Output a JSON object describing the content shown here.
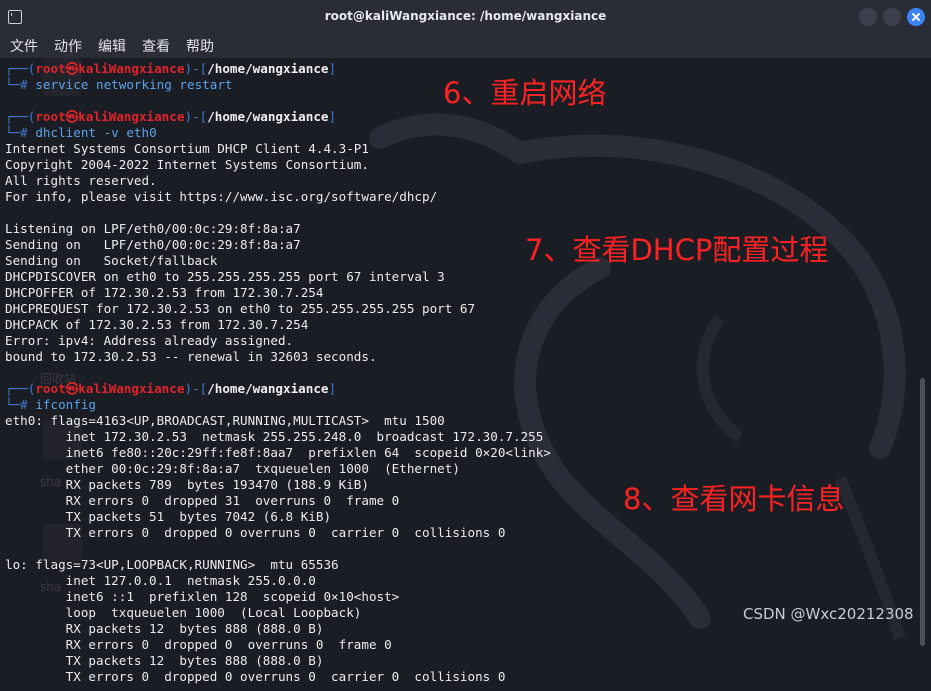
{
  "window": {
    "title": "root@kaliWangxiance: /home/wangxiance"
  },
  "menu": [
    "文件",
    "动作",
    "编辑",
    "查看",
    "帮助"
  ],
  "desktop": {
    "labels": [
      "回收站",
      "sha",
      "sha"
    ]
  },
  "prompt": {
    "user": "root",
    "host": "kaliWangxiance",
    "path": "/home/wangxiance"
  },
  "commands": [
    "service networking restart",
    "dhclient -v eth0",
    "ifconfig"
  ],
  "dhclient_output": [
    "Internet Systems Consortium DHCP Client 4.4.3-P1",
    "Copyright 2004-2022 Internet Systems Consortium.",
    "All rights reserved.",
    "For info, please visit https://www.isc.org/software/dhcp/",
    "",
    "Listening on LPF/eth0/00:0c:29:8f:8a:a7",
    "Sending on   LPF/eth0/00:0c:29:8f:8a:a7",
    "Sending on   Socket/fallback",
    "DHCPDISCOVER on eth0 to 255.255.255.255 port 67 interval 3",
    "DHCPOFFER of 172.30.2.53 from 172.30.7.254",
    "DHCPREQUEST for 172.30.2.53 on eth0 to 255.255.255.255 port 67",
    "DHCPACK of 172.30.2.53 from 172.30.7.254",
    "Error: ipv4: Address already assigned.",
    "bound to 172.30.2.53 -- renewal in 32603 seconds."
  ],
  "ifconfig_output": [
    "eth0: flags=4163<UP,BROADCAST,RUNNING,MULTICAST>  mtu 1500",
    "        inet 172.30.2.53  netmask 255.255.248.0  broadcast 172.30.7.255",
    "        inet6 fe80::20c:29ff:fe8f:8aa7  prefixlen 64  scopeid 0×20<link>",
    "        ether 00:0c:29:8f:8a:a7  txqueuelen 1000  (Ethernet)",
    "        RX packets 789  bytes 193470 (188.9 KiB)",
    "        RX errors 0  dropped 31  overruns 0  frame 0",
    "        TX packets 51  bytes 7042 (6.8 KiB)",
    "        TX errors 0  dropped 0 overruns 0  carrier 0  collisions 0",
    "",
    "lo: flags=73<UP,LOOPBACK,RUNNING>  mtu 65536",
    "        inet 127.0.0.1  netmask 255.0.0.0",
    "        inet6 ::1  prefixlen 128  scopeid 0×10<host>",
    "        loop  txqueuelen 1000  (Local Loopback)",
    "        RX packets 12  bytes 888 (888.0 B)",
    "        RX errors 0  dropped 0  overruns 0  frame 0",
    "        TX packets 12  bytes 888 (888.0 B)",
    "        TX errors 0  dropped 0 overruns 0  carrier 0  collisions 0"
  ],
  "annotations": [
    "6、重启网络",
    "7、查看DHCP配置过程",
    "8、查看网卡信息"
  ],
  "watermark": "CSDN @Wxc20212308",
  "colors": {
    "prompt_bracket": "#3d7bd4",
    "prompt_user": "#e0242a",
    "command": "#5aa4ec",
    "annotation": "#ff2222",
    "close_button": "#3b82f6"
  }
}
